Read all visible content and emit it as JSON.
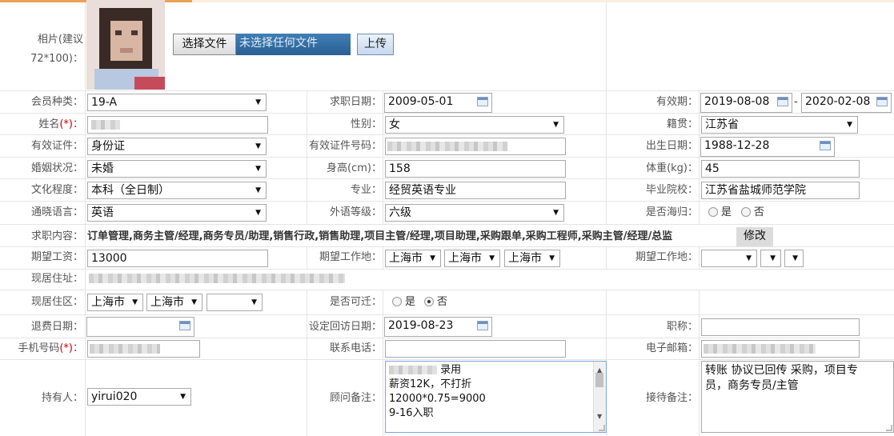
{
  "photo": {
    "label": "相片(建议72*100)：",
    "choose_label": "选择文件",
    "no_file_text": "未选择任何文件",
    "upload_label": "上传"
  },
  "row1": {
    "member_type_label": "会员种类：",
    "member_type": "19-A",
    "apply_date_label": "求职日期：",
    "apply_date": "2009-05-01",
    "valid_label": "有效期：",
    "valid_from": "2019-08-08",
    "valid_sep": "-",
    "valid_to": "2020-02-08"
  },
  "row2": {
    "name_label": "姓名",
    "name_req": "(*)",
    "name_colon": "：",
    "gender_label": "性别：",
    "gender": "女",
    "native_label": "籍贯：",
    "native": "江苏省"
  },
  "row3": {
    "id_type_label": "有效证件：",
    "id_type": "身份证",
    "id_no_label": "有效证件号码：",
    "birth_label": "出生日期：",
    "birth": "1988-12-28"
  },
  "row4": {
    "marital_label": "婚姻状况：",
    "marital": "未婚",
    "height_label": "身高(cm)：",
    "height": "158",
    "weight_label": "体重(kg)：",
    "weight": "45"
  },
  "row5": {
    "edu_label": "文化程度：",
    "edu": "本科（全日制）",
    "major_label": "专业：",
    "major": "经贸英语专业",
    "school_label": "毕业院校：",
    "school": "江苏省盐城师范学院"
  },
  "row6": {
    "lang_label": "通晓语言：",
    "lang": "英语",
    "level_label": "外语等级：",
    "level": "六级",
    "overseas_label": "是否海归：",
    "yes": "是",
    "no": "否"
  },
  "row7": {
    "job_label": "求职内容：",
    "job_content": "订单管理,商务主管/经理,商务专员/助理,销售行政,销售助理,项目主管/经理,项目助理,采购跟单,采购工程师,采购主管/经理/总监",
    "modify_label": "修改"
  },
  "row8": {
    "salary_label": "期望工资：",
    "salary": "13000",
    "workplace_label": "期望工作地：",
    "workplace1": "上海市",
    "workplace2": "上海市",
    "workplace3": "上海市",
    "workplace_b_label": "期望工作地："
  },
  "row9": {
    "address_label": "现居住址："
  },
  "row10": {
    "area_label": "现居住区：",
    "area1": "上海市",
    "area2": "上海市",
    "relocate_label": "是否可迁：",
    "yes": "是",
    "no": "否"
  },
  "row11": {
    "refund_label": "退费日期：",
    "revisit_label": "设定回访日期：",
    "revisit": "2019-08-23",
    "title_label": "职称："
  },
  "row12": {
    "mobile_label": "手机号码",
    "mobile_req": "(*)",
    "mobile_colon": "：",
    "phone_label": "联系电话：",
    "email_label": "电子邮箱："
  },
  "row13": {
    "holder_label": "持有人：",
    "holder": "yirui020",
    "consultant_label": "顾问备注：",
    "consultant_notes": [
      "录用",
      "薪资12K，不打折",
      "12000*0.75=9000",
      "9-16入职"
    ],
    "reception_label": "接待备注：",
    "reception_notes": [
      "转账 协议已回传 采购，项目专",
      "员，商务专员/主管"
    ]
  },
  "icons": {
    "dropdown": "chevron-down-icon",
    "calendar": "calendar-icon"
  }
}
